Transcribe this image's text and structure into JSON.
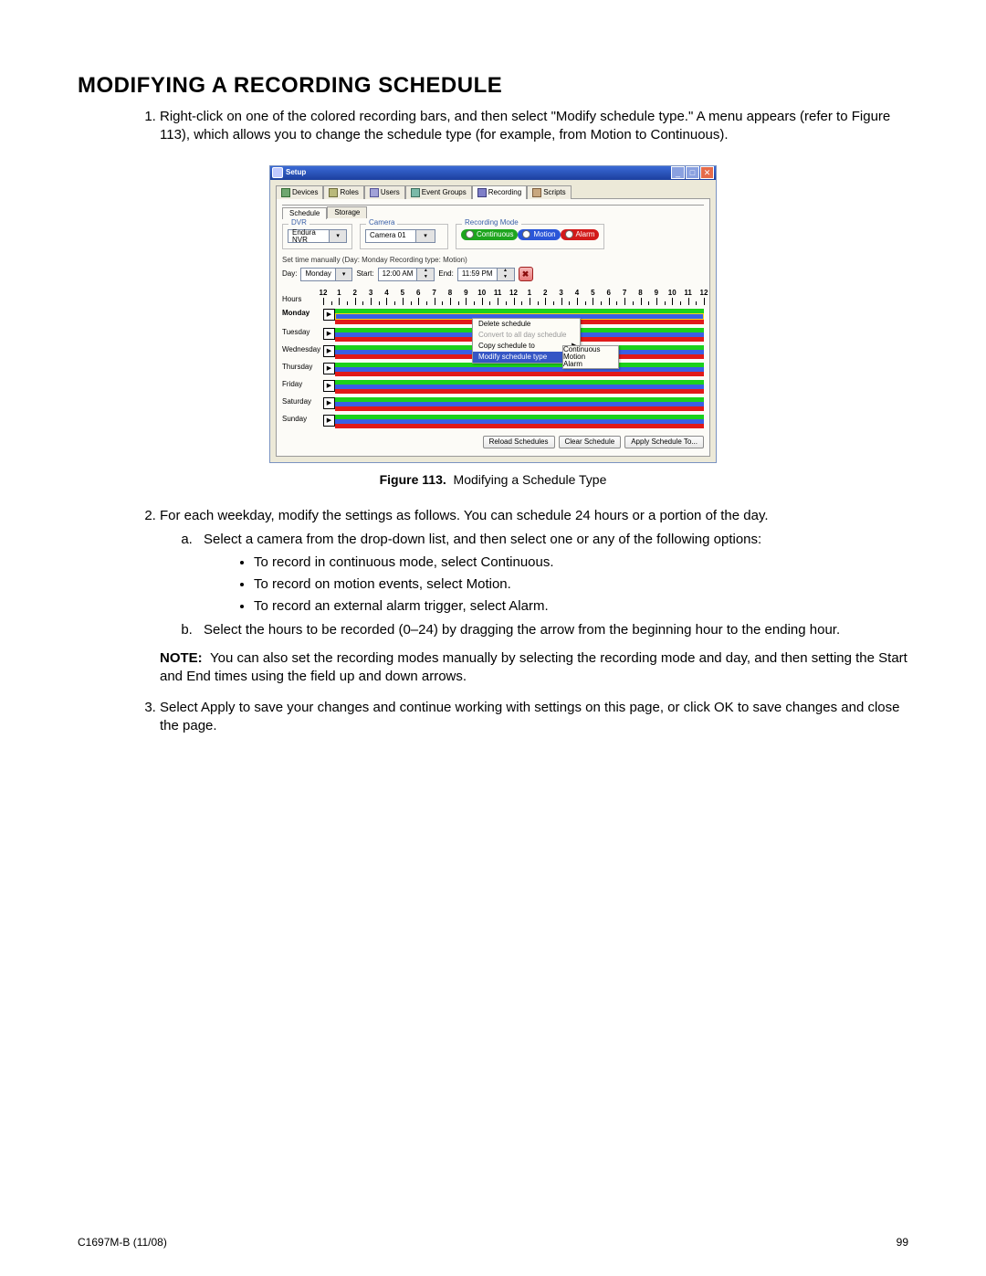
{
  "heading": "MODIFYING A RECORDING SCHEDULE",
  "steps": {
    "s1": "Right-click on one of the colored recording bars, and then select \"Modify schedule type.\" A menu appears (refer to Figure 113), which allows you to change the schedule type (for example, from Motion to Continuous).",
    "s2_lead": "For each weekday, modify the settings as follows. You can schedule 24 hours or a portion of the day.",
    "s2a": "Select a camera from the drop-down list, and then select one or any of the following options:",
    "s2a_b1": "To record in continuous mode, select Continuous.",
    "s2a_b2": "To record on motion events, select Motion.",
    "s2a_b3": "To record an external alarm trigger, select Alarm.",
    "s2b": "Select the hours to be recorded (0–24) by dragging the arrow from the beginning hour to the ending hour.",
    "note_label": "NOTE:",
    "note_body": "You can also set the recording modes manually by selecting the recording mode and day, and then setting the Start and End times using the field up and down arrows.",
    "s3": "Select Apply to save your changes and continue working with settings on this page, or click OK to save changes and close the page."
  },
  "figure": {
    "label": "Figure 113.",
    "caption": "Modifying a Schedule Type"
  },
  "footer": {
    "left": "C1697M-B (11/08)",
    "right": "99"
  },
  "ui": {
    "window_title": "Setup",
    "tabs": {
      "devices": "Devices",
      "roles": "Roles",
      "users": "Users",
      "eventgroups": "Event Groups",
      "recording": "Recording",
      "scripts": "Scripts"
    },
    "subtabs": {
      "schedule": "Schedule",
      "storage": "Storage"
    },
    "groups": {
      "dvr": "DVR",
      "camera": "Camera",
      "mode": "Recording Mode"
    },
    "dvr_value": "Endura NVR",
    "camera_value": "Camera 01",
    "mode": {
      "continuous": "Continuous",
      "motion": "Motion",
      "alarm": "Alarm"
    },
    "manual_title": "Set time manually (Day: Monday  Recording type: Motion)",
    "day_label": "Day:",
    "day_value": "Monday",
    "start_label": "Start:",
    "start_value": "12:00 AM",
    "end_label": "End:",
    "end_value": "11:59 PM",
    "hours_label": "Hours",
    "hour_numbers": [
      "12",
      "1",
      "2",
      "3",
      "4",
      "5",
      "6",
      "7",
      "8",
      "9",
      "10",
      "11",
      "12",
      "1",
      "2",
      "3",
      "4",
      "5",
      "6",
      "7",
      "8",
      "9",
      "10",
      "11",
      "12"
    ],
    "days": [
      "Monday",
      "Tuesday",
      "Wednesday",
      "Thursday",
      "Friday",
      "Saturday",
      "Sunday"
    ],
    "context_menu": {
      "delete": "Delete schedule",
      "convert": "Convert to all day schedule",
      "copy": "Copy schedule to",
      "modify": "Modify schedule type"
    },
    "context_sub": {
      "continuous": "Continuous",
      "motion": "Motion",
      "alarm": "Alarm"
    },
    "footer_buttons": {
      "reload": "Reload Schedules",
      "clear": "Clear Schedule",
      "apply": "Apply Schedule To..."
    }
  }
}
